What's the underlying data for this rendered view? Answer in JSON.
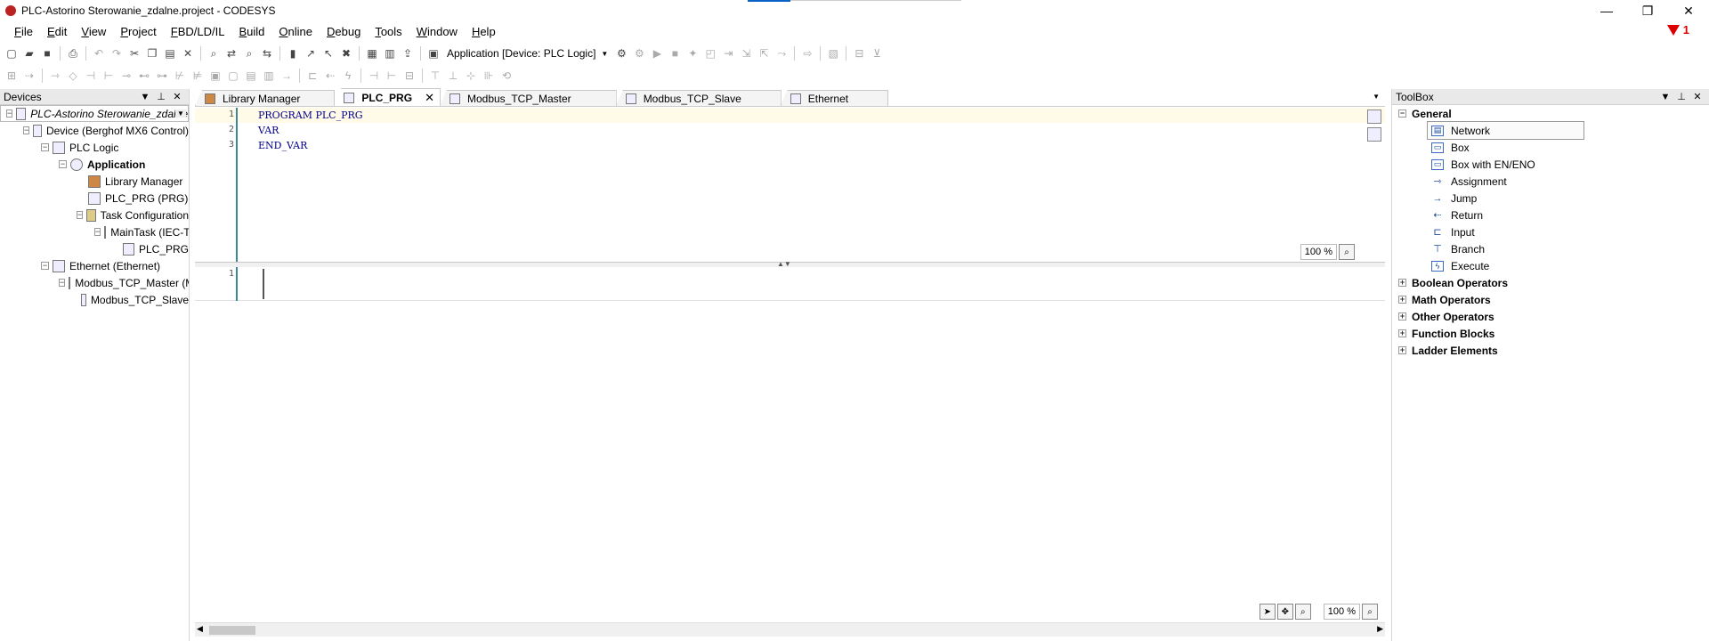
{
  "window": {
    "title": "PLC-Astorino Sterowanie_zdalne.project - CODESYS",
    "controls": {
      "minimize": "—",
      "restore": "❐",
      "close": "✕"
    }
  },
  "menu": [
    "File",
    "Edit",
    "View",
    "Project",
    "FBD/LD/IL",
    "Build",
    "Online",
    "Debug",
    "Tools",
    "Window",
    "Help"
  ],
  "messages": {
    "count": "1"
  },
  "toolbar": {
    "application_combo": "Application [Device: PLC Logic]"
  },
  "devices": {
    "title": "Devices",
    "tree": [
      {
        "label": "PLC-Astorino Sterowanie_zdalne",
        "style": "italic"
      },
      {
        "label": "Device (Berghof MX6 Control)"
      },
      {
        "label": "PLC Logic"
      },
      {
        "label": "Application",
        "style": "bold"
      },
      {
        "label": "Library Manager"
      },
      {
        "label": "PLC_PRG (PRG)"
      },
      {
        "label": "Task Configuration"
      },
      {
        "label": "MainTask (IEC-Tasks)"
      },
      {
        "label": "PLC_PRG"
      },
      {
        "label": "Ethernet (Ethernet)"
      },
      {
        "label": "Modbus_TCP_Master (Modbus TCP Master)"
      },
      {
        "label": "Modbus_TCP_Slave"
      }
    ]
  },
  "tabs": [
    {
      "label": "Library Manager"
    },
    {
      "label": "PLC_PRG",
      "active": true,
      "close": "✕"
    },
    {
      "label": "Modbus_TCP_Master"
    },
    {
      "label": "Modbus_TCP_Slave"
    },
    {
      "label": "Ethernet"
    }
  ],
  "declaration": {
    "lines": [
      {
        "no": "1",
        "text": "PROGRAM PLC_PRG"
      },
      {
        "no": "2",
        "text": "VAR"
      },
      {
        "no": "3",
        "text": "END_VAR"
      }
    ],
    "zoom": "100 %"
  },
  "network": {
    "number": "1",
    "zoom": "100 %"
  },
  "toolbox": {
    "title": "ToolBox",
    "general": {
      "label": "General",
      "items": [
        "Network",
        "Box",
        "Box with EN/ENO",
        "Assignment",
        "Jump",
        "Return",
        "Input",
        "Branch",
        "Execute"
      ]
    },
    "groups": [
      "Boolean Operators",
      "Math Operators",
      "Other Operators",
      "Function Blocks",
      "Ladder Elements"
    ]
  }
}
